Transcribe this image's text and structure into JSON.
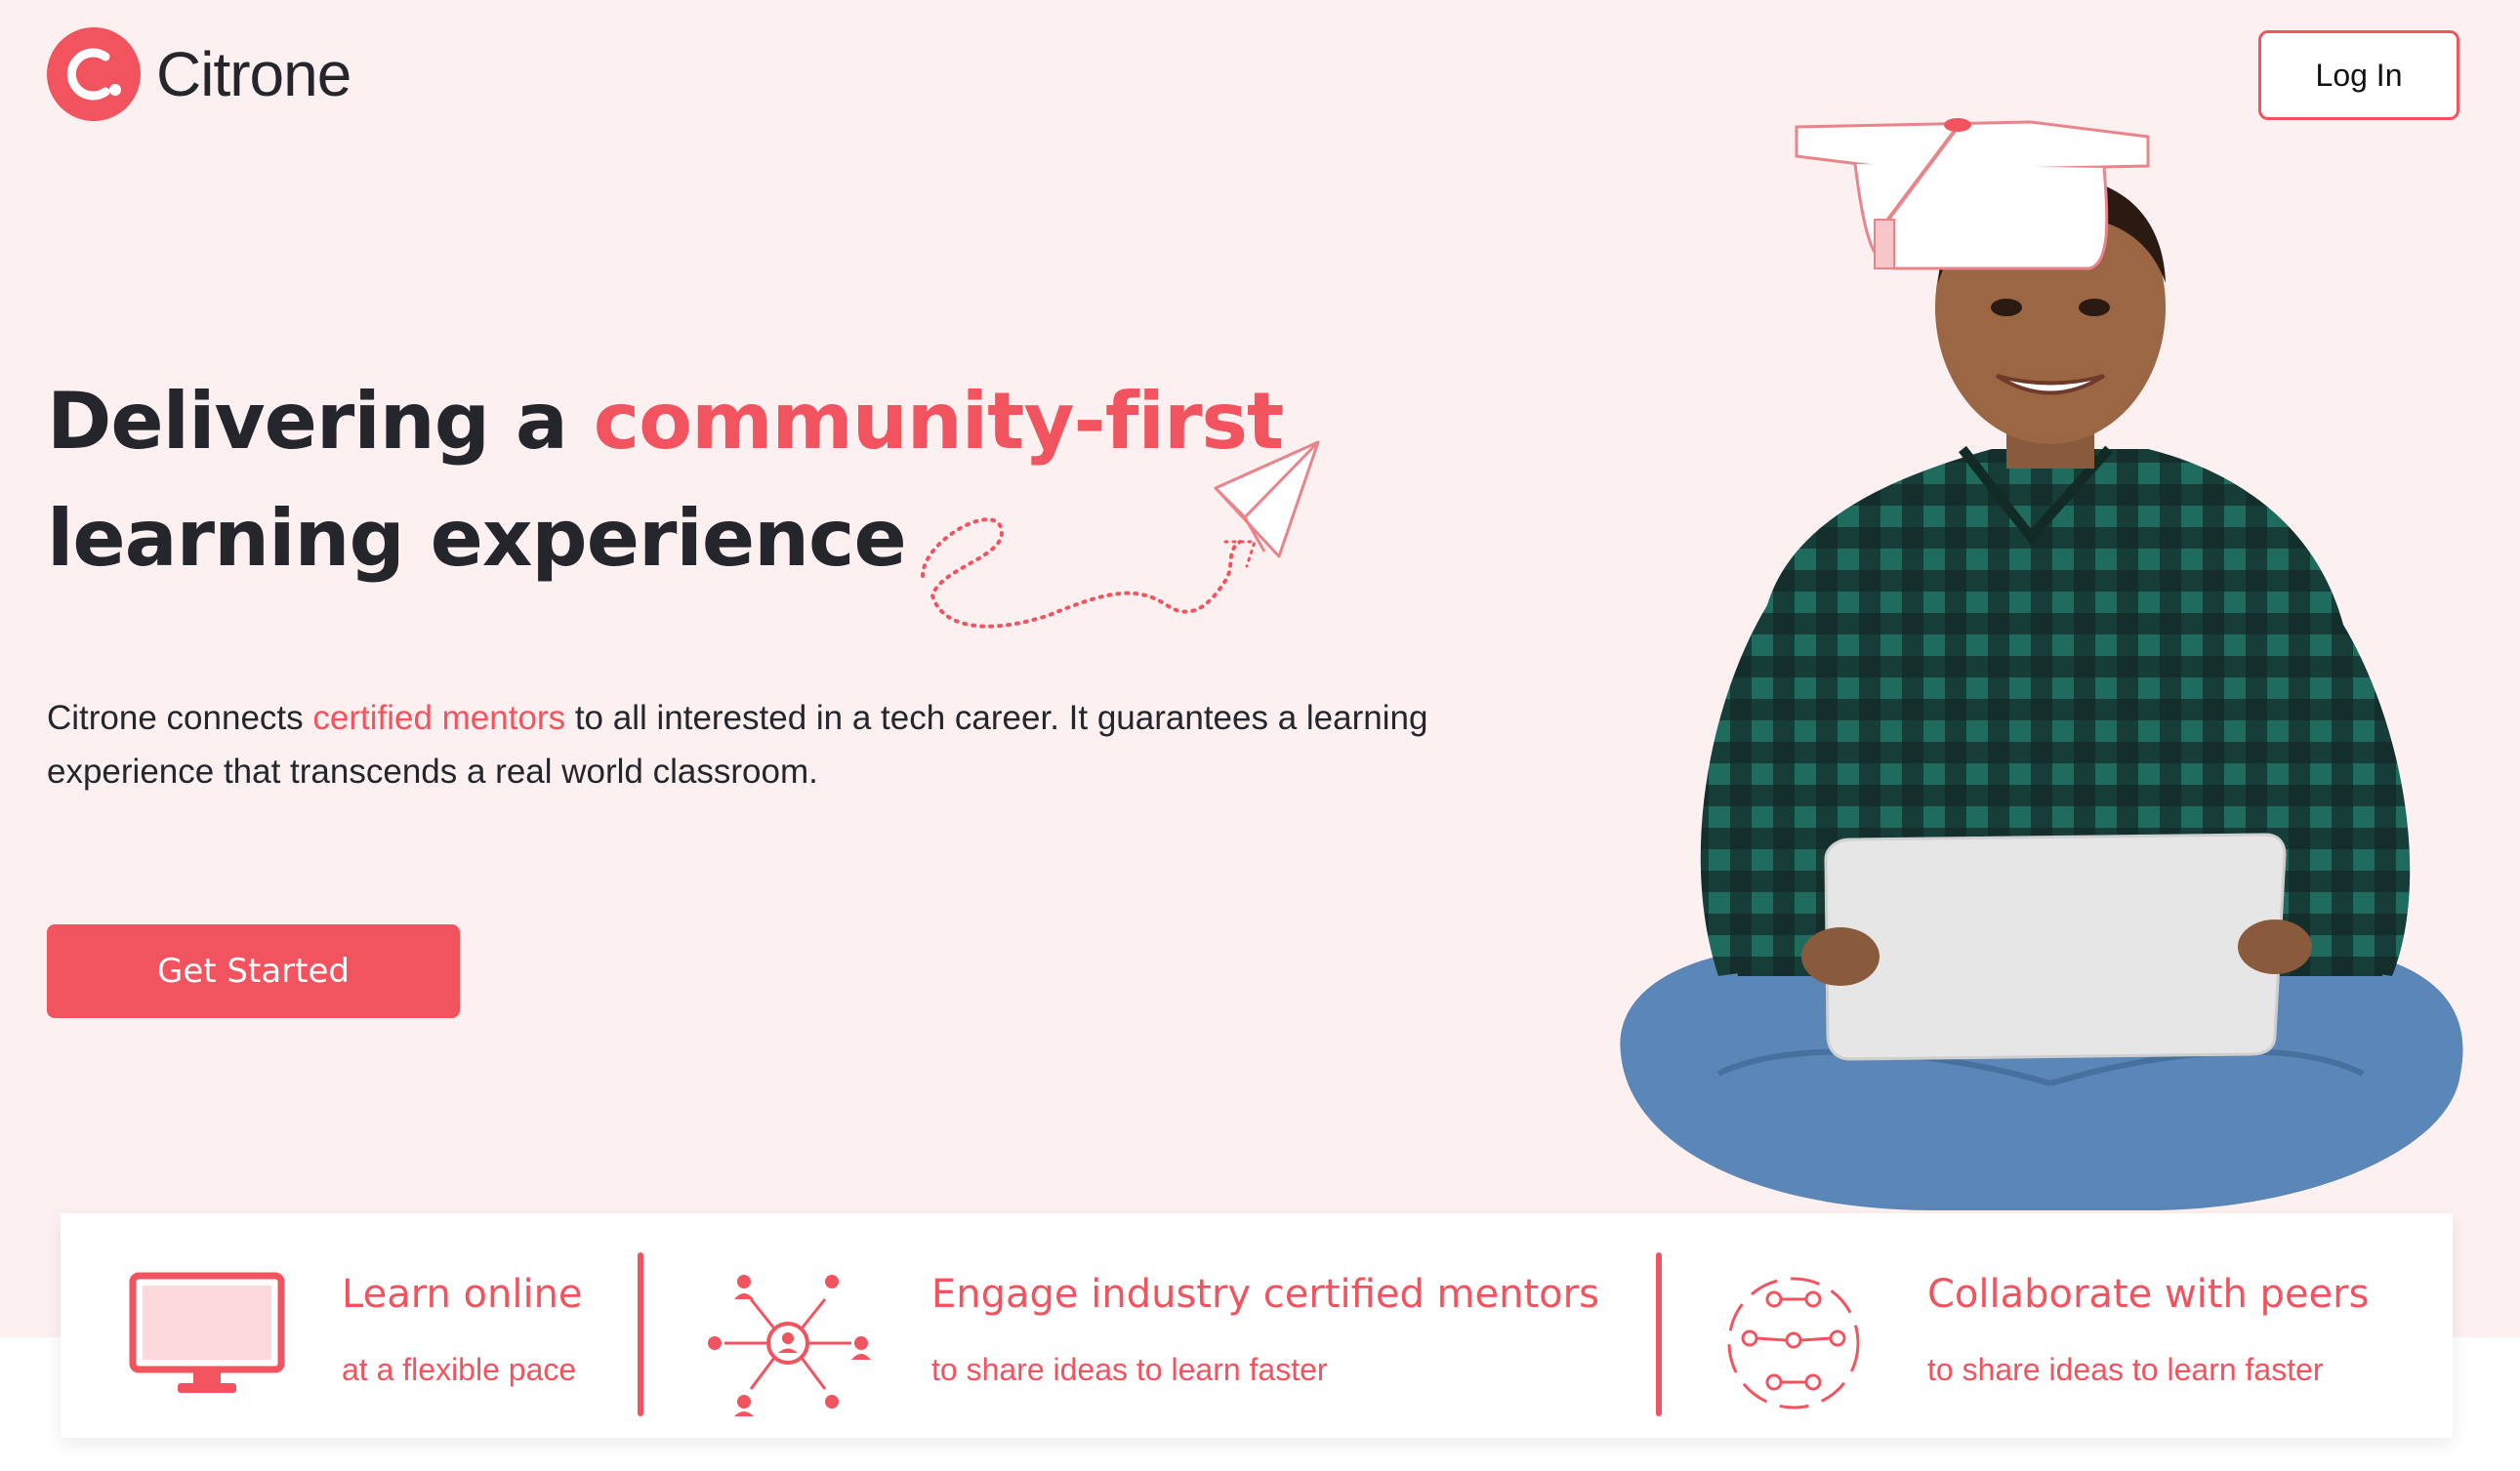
{
  "header": {
    "brand_mark": "c.",
    "brand_name": "Citrone",
    "login_label": "Log In"
  },
  "hero": {
    "title_part1": "Delivering a ",
    "title_accent": "community-first",
    "title_line2": "learning experience",
    "desc_part1": "Citrone connects ",
    "desc_accent": "certified mentors",
    "desc_part2": " to all interested in a tech career. It guarantees a learning experience that transcends a real world classroom.",
    "cta_label": "Get Started"
  },
  "features": [
    {
      "icon": "monitor-icon",
      "title": "Learn online",
      "subtitle": "at a flexible pace"
    },
    {
      "icon": "network-icon",
      "title": "Engage industry certified mentors",
      "subtitle": "to share ideas to learn faster"
    },
    {
      "icon": "collaborate-icon",
      "title": "Collaborate with peers",
      "subtitle": "to share ideas to learn faster"
    }
  ],
  "colors": {
    "accent": "#f2545f",
    "background": "#fdf0f1",
    "text": "#24262b"
  }
}
